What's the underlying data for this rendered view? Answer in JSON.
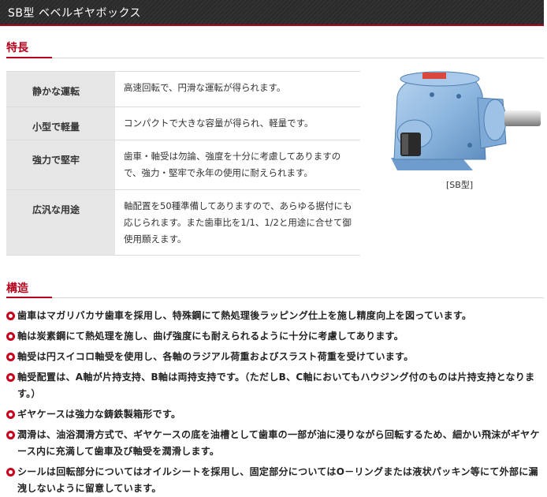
{
  "page_title": "SB型 ベベルギヤボックス",
  "features": {
    "heading": "特長",
    "rows": [
      {
        "label": "静かな運転",
        "text": "高速回転で、円滑な運転が得られます。"
      },
      {
        "label": "小型で軽量",
        "text": "コンパクトで大きな容量が得られ、軽量です。"
      },
      {
        "label": "強力で堅牢",
        "text": "歯車・軸受は勿論、強度を十分に考慮してありますので、強力・堅牢で永年の使用に耐えられます。"
      },
      {
        "label": "広汎な用途",
        "text": "軸配置を50種準備してありますので、あらゆる据付にも応じられます。また歯車比を1/1、1/2と用途に合せて御使用願えます。"
      }
    ]
  },
  "product": {
    "caption": "[SB型]",
    "body_color": "#8fb8e0",
    "icon": "gearbox-image"
  },
  "structure": {
    "heading": "構造",
    "items": [
      "歯車はマガリバカサ歯車を採用し、特殊鋼にて熱処理後ラッピング仕上を施し精度向上を図っています。",
      "軸は炭素鋼にて熱処理を施し、曲げ強度にも耐えられるように十分に考慮してあります。",
      "軸受は円スイコロ軸受を使用し、各軸のラジアル荷重およびスラスト荷重を受けています。",
      "軸受配置は、A軸が片持支持、B軸は両持支持です。（ただしB、C軸においてもハウジング付のものは片持支持となります。）",
      "ギヤケースは強力な鋳鉄製箱形です。",
      "潤滑は、油浴潤滑方式で、ギヤケースの底を油槽として歯車の一部が油に浸りながら回転するため、細かい飛沫がギヤケース内に充満して歯車及び軸受を潤滑します。",
      "シールは回転部分についてはオイルシートを採用し、固定部分についてはO－リングまたは液状パッキン等にて外部に漏洩しないように留意しています。"
    ]
  },
  "colors": {
    "accent": "#b4001b",
    "header_bg": "#2b2b2b",
    "table_key_bg": "#e6e6e6"
  }
}
